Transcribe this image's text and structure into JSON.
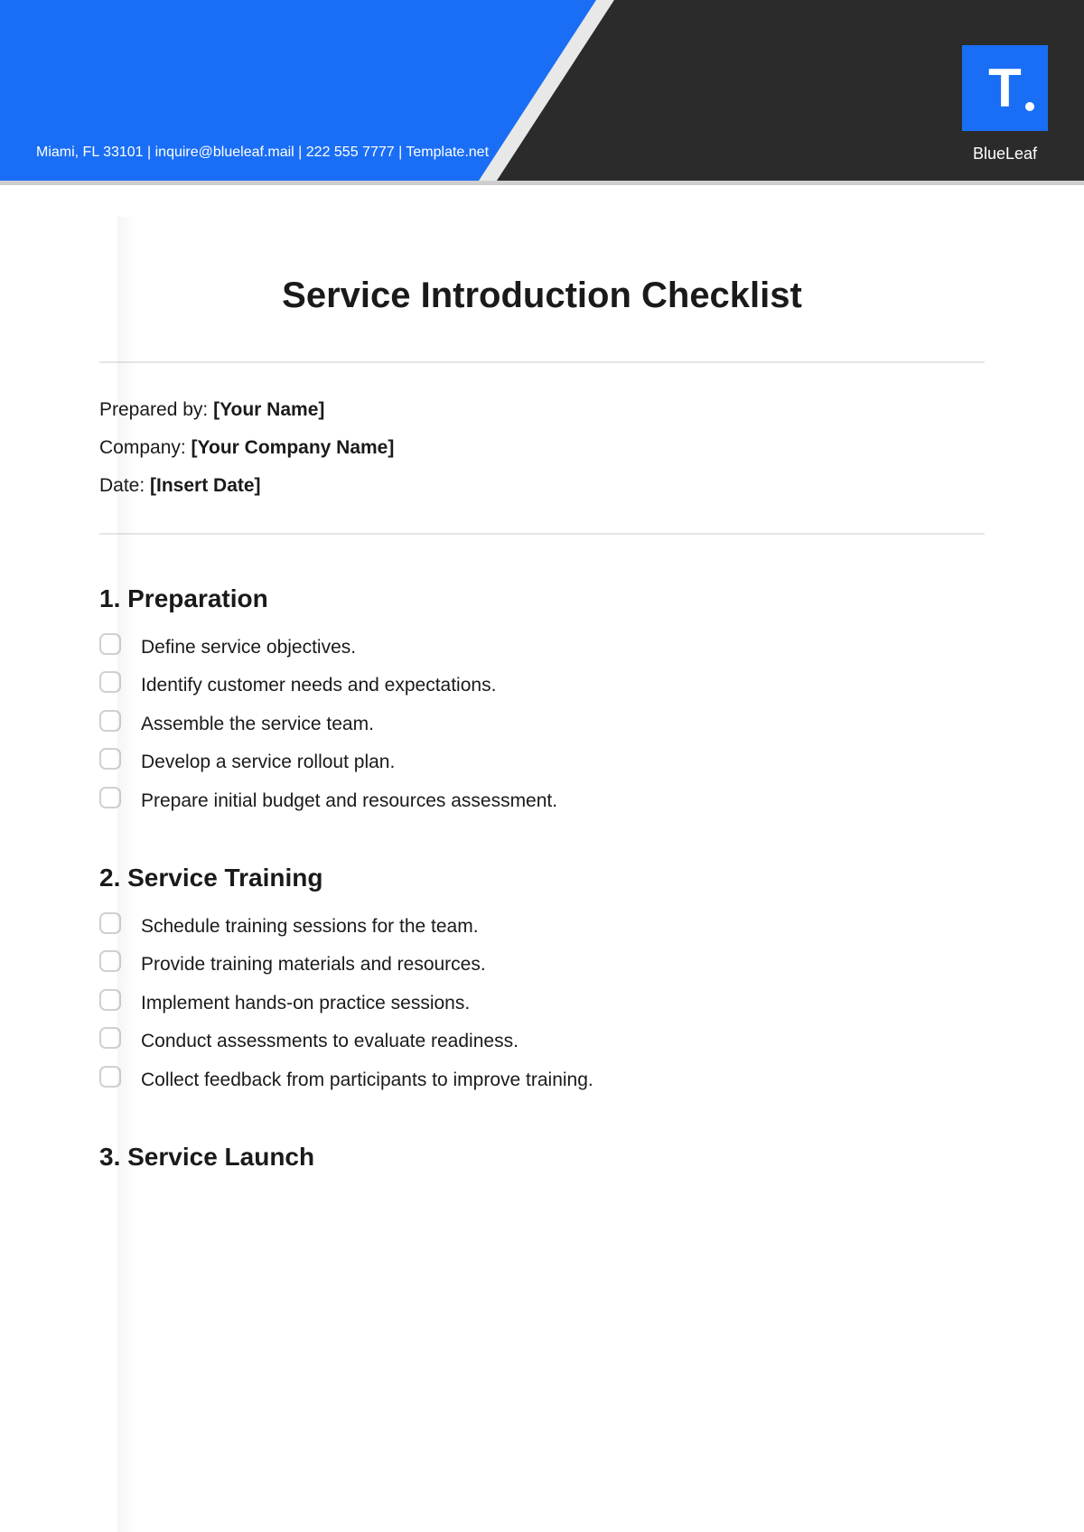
{
  "header": {
    "info_line": "Miami, FL 33101 | inquire@blueleaf.mail | 222 555 7777 | Template.net",
    "brand_name": "BlueLeaf",
    "logo_letter": "T"
  },
  "document": {
    "title": "Service Introduction Checklist"
  },
  "meta": {
    "prepared_label": "Prepared by: ",
    "prepared_value": "[Your Name]",
    "company_label": "Company: ",
    "company_value": "[Your Company Name]",
    "date_label": "Date: ",
    "date_value": "[Insert Date]"
  },
  "sections": {
    "s1": {
      "heading": "1. Preparation",
      "items": {
        "i0": "Define service objectives.",
        "i1": "Identify customer needs and expectations.",
        "i2": "Assemble the service team.",
        "i3": "Develop a service rollout plan.",
        "i4": "Prepare initial budget and resources assessment."
      }
    },
    "s2": {
      "heading": "2. Service Training",
      "items": {
        "i0": "Schedule training sessions for the team.",
        "i1": "Provide training materials and resources.",
        "i2": "Implement hands-on practice sessions.",
        "i3": "Conduct assessments to evaluate readiness.",
        "i4": "Collect feedback from participants to improve training."
      }
    },
    "s3": {
      "heading": "3. Service Launch"
    }
  }
}
